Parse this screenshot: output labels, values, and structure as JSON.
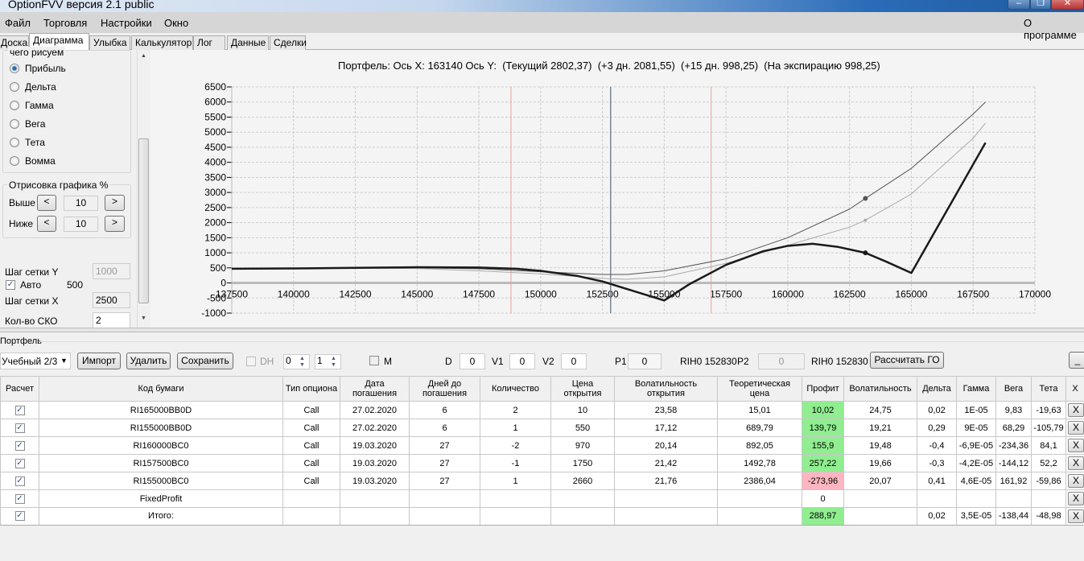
{
  "window": {
    "title": "OptionFVV версия 2.1 public",
    "minimize": "–",
    "restore": "❐",
    "close": "✕"
  },
  "menu": {
    "items": [
      "Файл",
      "Торговля",
      "Настройки",
      "Окно"
    ],
    "about": "О программе"
  },
  "tabs": [
    "Доска",
    "Диаграмма",
    "Улыбка",
    "Калькулятор",
    "Лог",
    "Данные",
    "Сделки"
  ],
  "active_tab": "Диаграмма",
  "left": {
    "draw_group": "чего рисуем",
    "radios": [
      {
        "label": "Прибыль",
        "checked": true
      },
      {
        "label": "Дельта",
        "checked": false
      },
      {
        "label": "Гамма",
        "checked": false
      },
      {
        "label": "Вега",
        "checked": false
      },
      {
        "label": "Тета",
        "checked": false
      },
      {
        "label": "Вомма",
        "checked": false
      }
    ],
    "render_group": "Отрисовка графика %",
    "above_label": "Выше",
    "above_value": "10",
    "below_label": "Ниже",
    "below_value": "10",
    "prev": "<",
    "next": ">",
    "grid_y_label": "Шаг сетки Y",
    "grid_y_value": "1000",
    "auto_label": "Авто",
    "auto_checked": true,
    "auto_value": "500",
    "grid_x_label": "Шаг сетки X",
    "grid_x_value": "2500",
    "sko_label": "Кол-во СКО",
    "sko_value": "2"
  },
  "chart_header": "Портфель: Ось X: 163140 Ось Y:  (Текущий 2802,37)  (+3 дн. 2081,55)  (+15 дн. 998,25)  (На экспирацию 998,25)",
  "chart_data": {
    "type": "line",
    "title": "Портфель: Ось X: 163140 Ось Y:  (Текущий 2802,37)  (+3 дн. 2081,55)  (+15 дн. 998,25)  (На экспирацию 998,25)",
    "xlim": [
      137500,
      170000
    ],
    "ylim": [
      -1000,
      6500
    ],
    "xticks": [
      137500,
      140000,
      142500,
      145000,
      147500,
      150000,
      152500,
      155000,
      157500,
      160000,
      162500,
      165000,
      167500,
      170000
    ],
    "yticks": [
      6500,
      6000,
      5500,
      5000,
      4500,
      4000,
      3500,
      3000,
      2500,
      2000,
      1500,
      1000,
      500,
      0,
      -500,
      -1000
    ],
    "grid": true,
    "cursor_x": 163140,
    "current_price_line": 152830,
    "sko_lines": [
      148800,
      156900
    ],
    "colors": {
      "current": "#555555",
      "plus3": "#aaaaaa",
      "expiry": "#1a1a1a",
      "sko": "#f0a0a0",
      "price": "#7a8696",
      "grid": "#cccccc"
    },
    "series": [
      {
        "name": "Текущий",
        "x": [
          137500,
          140000,
          142500,
          145000,
          147500,
          150000,
          152500,
          153500,
          155000,
          157500,
          160000,
          162500,
          163140,
          165000,
          167500,
          168000
        ],
        "y": [
          460,
          470,
          490,
          500,
          470,
          370,
          280,
          280,
          400,
          800,
          1500,
          2450,
          2802,
          3800,
          5600,
          6000
        ]
      },
      {
        "name": "+3 дн.",
        "x": [
          137500,
          140000,
          142500,
          145000,
          147500,
          150000,
          152500,
          153500,
          155000,
          157500,
          160000,
          162500,
          163140,
          165000,
          167500,
          168000
        ],
        "y": [
          460,
          470,
          490,
          480,
          400,
          300,
          150,
          120,
          200,
          650,
          1250,
          1850,
          2081,
          2950,
          4800,
          5300
        ]
      },
      {
        "name": "На экспирацию",
        "x": [
          137500,
          140000,
          142500,
          145000,
          147500,
          149000,
          150000,
          151500,
          152500,
          155000,
          156000,
          157500,
          159000,
          160000,
          161000,
          162000,
          163140,
          164000,
          165000,
          168000
        ],
        "y": [
          470,
          480,
          500,
          520,
          510,
          470,
          400,
          230,
          50,
          -580,
          -50,
          600,
          1050,
          1230,
          1300,
          1200,
          998,
          700,
          330,
          4650
        ]
      }
    ]
  },
  "portfolio": {
    "group": "Портфель",
    "selected": "Учебный 2/3",
    "import": "Импорт",
    "delete": "Удалить",
    "save": "Сохранить",
    "dh": "DH",
    "spin1": "0",
    "spin2": "1",
    "m": "M",
    "d_label": "D",
    "d": "0",
    "v1_label": "V1",
    "v1": "0",
    "v2_label": "V2",
    "v2": "0",
    "p1_label": "P1",
    "p1": "0",
    "p1_ticker": "RIH0 152830",
    "p2_label": "P2",
    "p2": "0",
    "p2_ticker": "RIH0 152830",
    "calc_go": "Рассчитать ГО",
    "collapse": "_"
  },
  "table": {
    "headers": [
      "Расчет",
      "Код бумаги",
      "Тип опциона",
      "Дата погашения",
      "Дней до погашения",
      "Количество",
      "Цена открытия",
      "Волатильность открытия",
      "Теоретическая цена",
      "Профит",
      "Волатильность",
      "Дельта",
      "Гамма",
      "Вега",
      "Тета",
      "X"
    ],
    "rows": [
      {
        "code": "RI165000BB0D",
        "type": "Call",
        "date": "27.02.2020",
        "days": "6",
        "qty": "2",
        "open": "10",
        "vol_open": "23,58",
        "theo": "15,01",
        "profit": "10,02",
        "profit_color": "#90ee90",
        "vol": "24,75",
        "delta": "0,02",
        "gamma": "1E-05",
        "vega": "9,83",
        "theta": "-19,63"
      },
      {
        "code": "RI155000BB0D",
        "type": "Call",
        "date": "27.02.2020",
        "days": "6",
        "qty": "1",
        "open": "550",
        "vol_open": "17,12",
        "theo": "689,79",
        "profit": "139,79",
        "profit_color": "#90ee90",
        "vol": "19,21",
        "delta": "0,29",
        "gamma": "9E-05",
        "vega": "68,29",
        "theta": "-105,79"
      },
      {
        "code": "RI160000BC0",
        "type": "Call",
        "date": "19.03.2020",
        "days": "27",
        "qty": "-2",
        "open": "970",
        "vol_open": "20,14",
        "theo": "892,05",
        "profit": "155,9",
        "profit_color": "#90ee90",
        "vol": "19,48",
        "delta": "-0,4",
        "gamma": "-6,9E-05",
        "vega": "-234,36",
        "theta": "84,1"
      },
      {
        "code": "RI157500BC0",
        "type": "Call",
        "date": "19.03.2020",
        "days": "27",
        "qty": "-1",
        "open": "1750",
        "vol_open": "21,42",
        "theo": "1492,78",
        "profit": "257,22",
        "profit_color": "#90ee90",
        "vol": "19,66",
        "delta": "-0,3",
        "gamma": "-4,2E-05",
        "vega": "-144,12",
        "theta": "52,2"
      },
      {
        "code": "RI155000BC0",
        "type": "Call",
        "date": "19.03.2020",
        "days": "27",
        "qty": "1",
        "open": "2660",
        "vol_open": "21,76",
        "theo": "2386,04",
        "profit": "-273,96",
        "profit_color": "#ffb6c1",
        "vol": "20,07",
        "delta": "0,41",
        "gamma": "4,6E-05",
        "vega": "161,92",
        "theta": "-59,86"
      },
      {
        "code": "FixedProfit",
        "type": "",
        "date": "",
        "days": "",
        "qty": "",
        "open": "",
        "vol_open": "",
        "theo": "",
        "profit": "0",
        "profit_color": "",
        "vol": "",
        "delta": "",
        "gamma": "",
        "vega": "",
        "theta": ""
      },
      {
        "code": "Итого:",
        "type": "",
        "date": "",
        "days": "",
        "qty": "",
        "open": "",
        "vol_open": "",
        "theo": "",
        "profit": "288,97",
        "profit_color": "#90ee90",
        "vol": "",
        "delta": "0,02",
        "gamma": "3,5E-05",
        "vega": "-138,44",
        "theta": "-48,98"
      }
    ],
    "delete_label": "X",
    "check_mark": "✓"
  }
}
